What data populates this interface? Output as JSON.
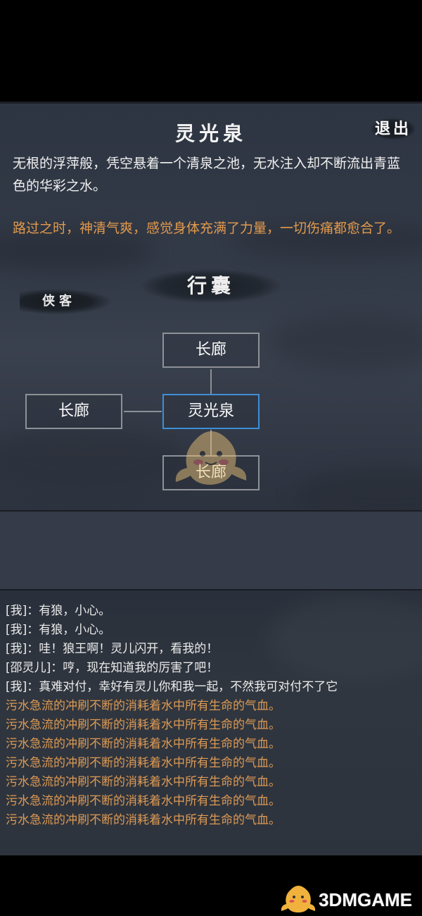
{
  "location": {
    "title": "灵光泉",
    "exit_label": "退出",
    "description": "无根的浮萍般，凭空悬着一个清泉之池，无水注入却不断流出青蓝色的华彩之水。",
    "event_text": "路过之时，神清气爽，感觉身体充满了力量，一切伤痛都愈合了。"
  },
  "menu": {
    "bag_label": "行囊",
    "hero_label": "侠客"
  },
  "map": {
    "current": "灵光泉",
    "north": "长廊",
    "west": "长廊",
    "south": "长廊"
  },
  "log": [
    {
      "text": "[我]：有狼，小心。",
      "type": "dialog"
    },
    {
      "text": "[我]：有狼，小心。",
      "type": "dialog"
    },
    {
      "text": "[我]：哇！狼王啊！灵儿闪开，看我的！",
      "type": "dialog"
    },
    {
      "text": "[邵灵儿]：哼，现在知道我的厉害了吧！",
      "type": "dialog"
    },
    {
      "text": "[我]：真难对付，幸好有灵儿你和我一起，不然我可对付不了它",
      "type": "dialog"
    },
    {
      "text": "污水急流的冲刷不断的消耗着水中所有生命的气血。",
      "type": "system"
    },
    {
      "text": "污水急流的冲刷不断的消耗着水中所有生命的气血。",
      "type": "system"
    },
    {
      "text": "污水急流的冲刷不断的消耗着水中所有生命的气血。",
      "type": "system"
    },
    {
      "text": "污水急流的冲刷不断的消耗着水中所有生命的气血。",
      "type": "system"
    },
    {
      "text": "污水急流的冲刷不断的消耗着水中所有生命的气血。",
      "type": "system"
    },
    {
      "text": "污水急流的冲刷不断的消耗着水中所有生命的气血。",
      "type": "system"
    },
    {
      "text": "污水急流的冲刷不断的消耗着水中所有生命的气血。",
      "type": "system"
    }
  ],
  "watermark": {
    "text": "3DMGAME",
    "icon": "mascot-logo-icon"
  },
  "colors": {
    "event_text": "#e29a4d",
    "system_log": "#dd9a54",
    "current_room_border": "#3d8fd6",
    "room_border": "#8e9196"
  }
}
